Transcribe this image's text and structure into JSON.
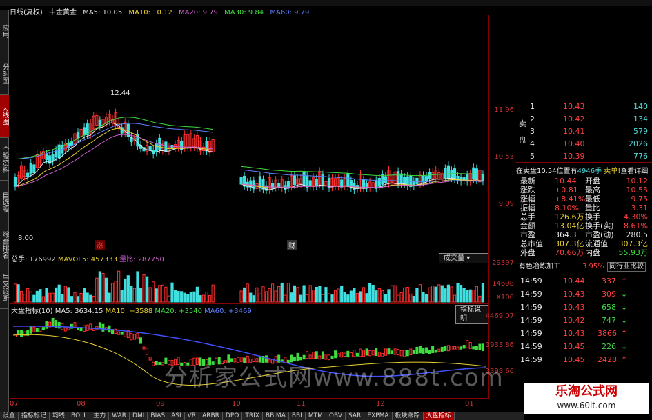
{
  "left_tabs": [
    "应用",
    "分时图",
    "K线图",
    "个股资料",
    "自选股",
    "综合排名",
    "牛叉诊断"
  ],
  "header": {
    "period": "日线(复权)",
    "name": "中金黄金",
    "ma5": "MA5: 10.05",
    "ma10": "MA10: 10.12",
    "ma20": "MA20: 9.79",
    "ma30": "MA30: 9.84",
    "ma60": "MA60: 9.79"
  },
  "price_axis": [
    "11.96",
    "10.53",
    "9.09"
  ],
  "annot": {
    "high": "12.44",
    "low": "8.00",
    "zhang": "涨",
    "cai": "财"
  },
  "vol": {
    "title": "总手: 176992",
    "mavol": "MAVOL5: 457333",
    "lb": "量比: 287750",
    "axis": [
      "29397",
      "14698",
      "X100"
    ],
    "btn": "成交量"
  },
  "ind": {
    "title": "大盘指标(10)",
    "ma5": "MA5: 3634.15",
    "ma10": "MA10: +3588",
    "ma20": "MA20: +3540",
    "ma60": "MA60: +3469",
    "btn": "指标说明",
    "axis": [
      "4469.07",
      "3933.86",
      "3398.66"
    ]
  },
  "xaxis": [
    "07",
    "08",
    "09",
    "10",
    "11",
    "12",
    "01"
  ],
  "orderbook": {
    "sell_label": "卖盘",
    "rows": [
      {
        "n": "1",
        "p": "10.43",
        "v": "140"
      },
      {
        "n": "2",
        "p": "10.42",
        "v": "134"
      },
      {
        "n": "3",
        "p": "10.41",
        "v": "579"
      },
      {
        "n": "4",
        "p": "10.40",
        "v": "2026"
      },
      {
        "n": "5",
        "p": "10.39",
        "v": "776"
      }
    ]
  },
  "bar": {
    "a": "在卖盘10.54位置有",
    "b": "4946手",
    "c": "卖单!",
    "d": "查看详细"
  },
  "stats": [
    [
      "最新",
      "10.44",
      "开盘",
      "10.12"
    ],
    [
      "涨跌",
      "+0.81",
      "最高",
      "10.55"
    ],
    [
      "涨幅",
      "+8.41%",
      "最低",
      "9.75"
    ],
    [
      "振幅",
      "8.10%",
      "量比",
      "3.31"
    ],
    [
      "总手",
      "126.6万",
      "换手",
      "4.30%"
    ],
    [
      "金额",
      "13.04亿",
      "换手(实)",
      "8.61%"
    ],
    [
      "市盈",
      "364.3",
      "市盈(动)",
      "280.5"
    ],
    [
      "总市值",
      "307.3亿",
      "流通值",
      "307.3亿"
    ],
    [
      "外盘",
      "70.66万",
      "内盘",
      "55.93万"
    ]
  ],
  "industry": {
    "name": "有色冶炼加工",
    "pct": "3.95%",
    "btn": "同行业比较"
  },
  "ticks": [
    [
      "14:59",
      "10.44",
      "337"
    ],
    [
      "14:59",
      "10.43",
      "309"
    ],
    [
      "14:59",
      "10.43",
      "658"
    ],
    [
      "14:59",
      "10.42",
      "747"
    ],
    [
      "14:59",
      "10.43",
      "3866"
    ],
    [
      "14:59",
      "10.45",
      "226"
    ],
    [
      "14:59",
      "10.45",
      "2428"
    ]
  ],
  "watermark": "分析家公式网www.888t.com",
  "logo": {
    "cn": "乐淘公式网",
    "url": "www.60lt.com"
  },
  "bottom_tabs": [
    "设置",
    "指标标记",
    "均线",
    "BOLL",
    "主力",
    "WAR",
    "DMI",
    "BIAS",
    "ASI",
    "VR",
    "ARBR",
    "DPO",
    "TRIX",
    "BBIMA",
    "BBI",
    "MTM",
    "OBV",
    "SAR",
    "EXPMA",
    "板块跟踪",
    "大盘指标"
  ]
}
